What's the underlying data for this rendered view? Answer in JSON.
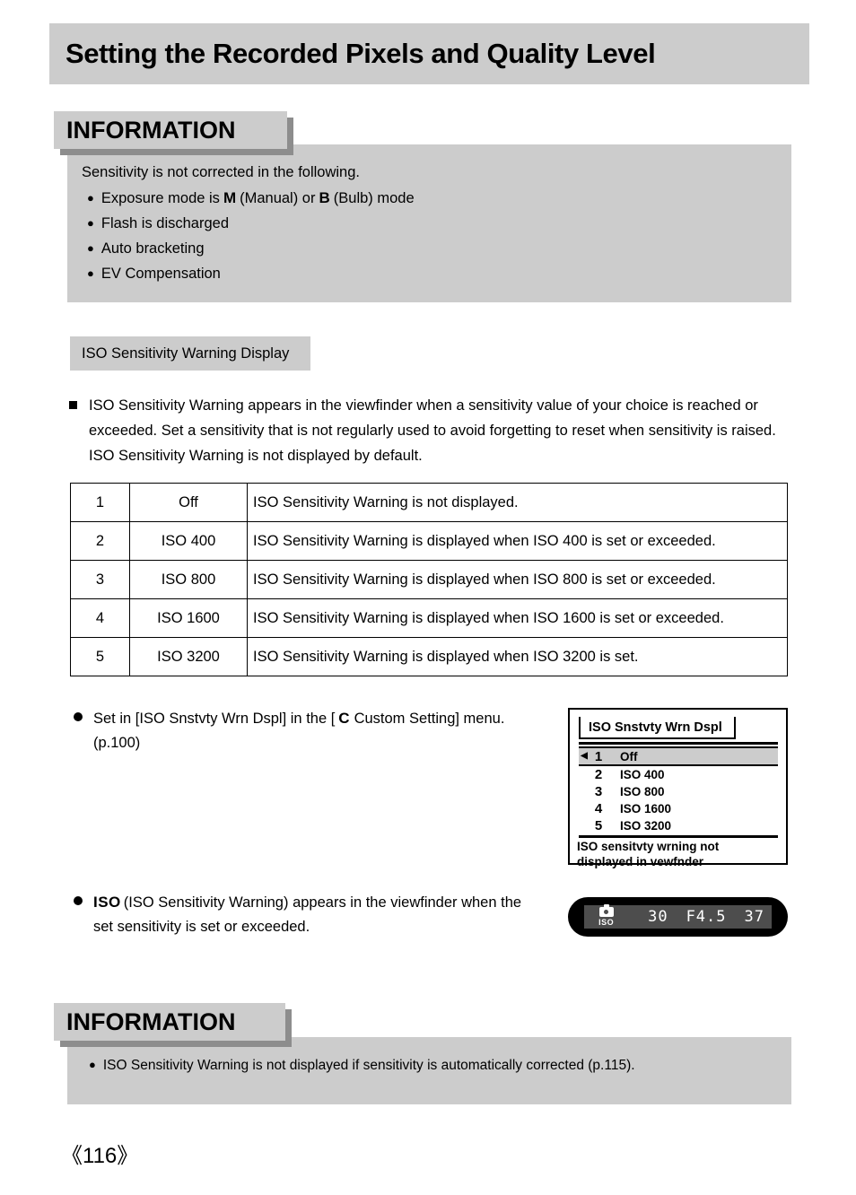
{
  "page": {
    "title": "Setting the Recorded Pixels and Quality Level",
    "number": "《116》"
  },
  "information_top": {
    "header": "INFORMATION",
    "lead": "Sensitivity is not corrected in the following.",
    "items": [
      {
        "prefix": "Exposure mode is",
        "glyph_manual": "M",
        "mid": "(Manual) or",
        "glyph_bulb": "B",
        "suffix": "(Bulb) mode"
      },
      {
        "text": "Flash is discharged"
      },
      {
        "text": "Auto bracketing"
      },
      {
        "text": "EV Compensation"
      }
    ]
  },
  "section": {
    "heading": "ISO Sensitivity Warning Display",
    "intro": "ISO Sensitivity Warning appears in the viewfinder when a sensitivity value of your choice is reached or exceeded. Set a sensitivity that is not regularly used to avoid forgetting to reset when sensitivity is raised. ISO Sensitivity Warning is not displayed by default."
  },
  "iso_table": {
    "rows": [
      {
        "num": "1",
        "value": "Off",
        "desc": "ISO Sensitivity Warning is not displayed."
      },
      {
        "num": "2",
        "value": "ISO 400",
        "desc": "ISO Sensitivity Warning is displayed when ISO 400 is set or exceeded."
      },
      {
        "num": "3",
        "value": "ISO 800",
        "desc": "ISO Sensitivity Warning is displayed when ISO 800 is set or exceeded."
      },
      {
        "num": "4",
        "value": "ISO 1600",
        "desc": "ISO Sensitivity Warning is displayed when ISO 1600 is set or exceeded."
      },
      {
        "num": "5",
        "value": "ISO 3200",
        "desc": "ISO Sensitivity Warning is displayed when ISO 3200 is set."
      }
    ]
  },
  "bullets": {
    "set_in": {
      "part1": "Set in [ISO Snstvty Wrn Dspl] in the [",
      "glyph": "C",
      "part2": "Custom Setting] menu.",
      "part3": "(p.100)"
    },
    "viewfinder": {
      "glyph": "ISO",
      "text": "(ISO Sensitivity Warning) appears in the viewfinder when the set sensitivity is set or exceeded."
    }
  },
  "lcd_menu": {
    "tab_title": "ISO Snstvty Wrn Dspl",
    "items": [
      {
        "num": "1",
        "label": "Off",
        "selected": true,
        "arrow": "◀"
      },
      {
        "num": "2",
        "label": "ISO 400",
        "selected": false,
        "arrow": ""
      },
      {
        "num": "3",
        "label": "ISO 800",
        "selected": false,
        "arrow": ""
      },
      {
        "num": "4",
        "label": "ISO 1600",
        "selected": false,
        "arrow": ""
      },
      {
        "num": "5",
        "label": "ISO 3200",
        "selected": false,
        "arrow": ""
      }
    ],
    "footer_line1": "ISO sensitvty wrning not",
    "footer_line2": "displayed in vewfnder"
  },
  "viewfinder_display": {
    "icon_label": "ISO",
    "shutter_speed": "30",
    "aperture": "F4.5",
    "frames": "37"
  },
  "information_bottom": {
    "header": "INFORMATION",
    "item": "ISO Sensitivity Warning is not displayed if sensitivity is automatically corrected (p.115)."
  },
  "colors": {
    "band_gray": "#cccccc",
    "shadow_gray": "#8d8d8d",
    "vf_bar": "#4d4d4d"
  }
}
